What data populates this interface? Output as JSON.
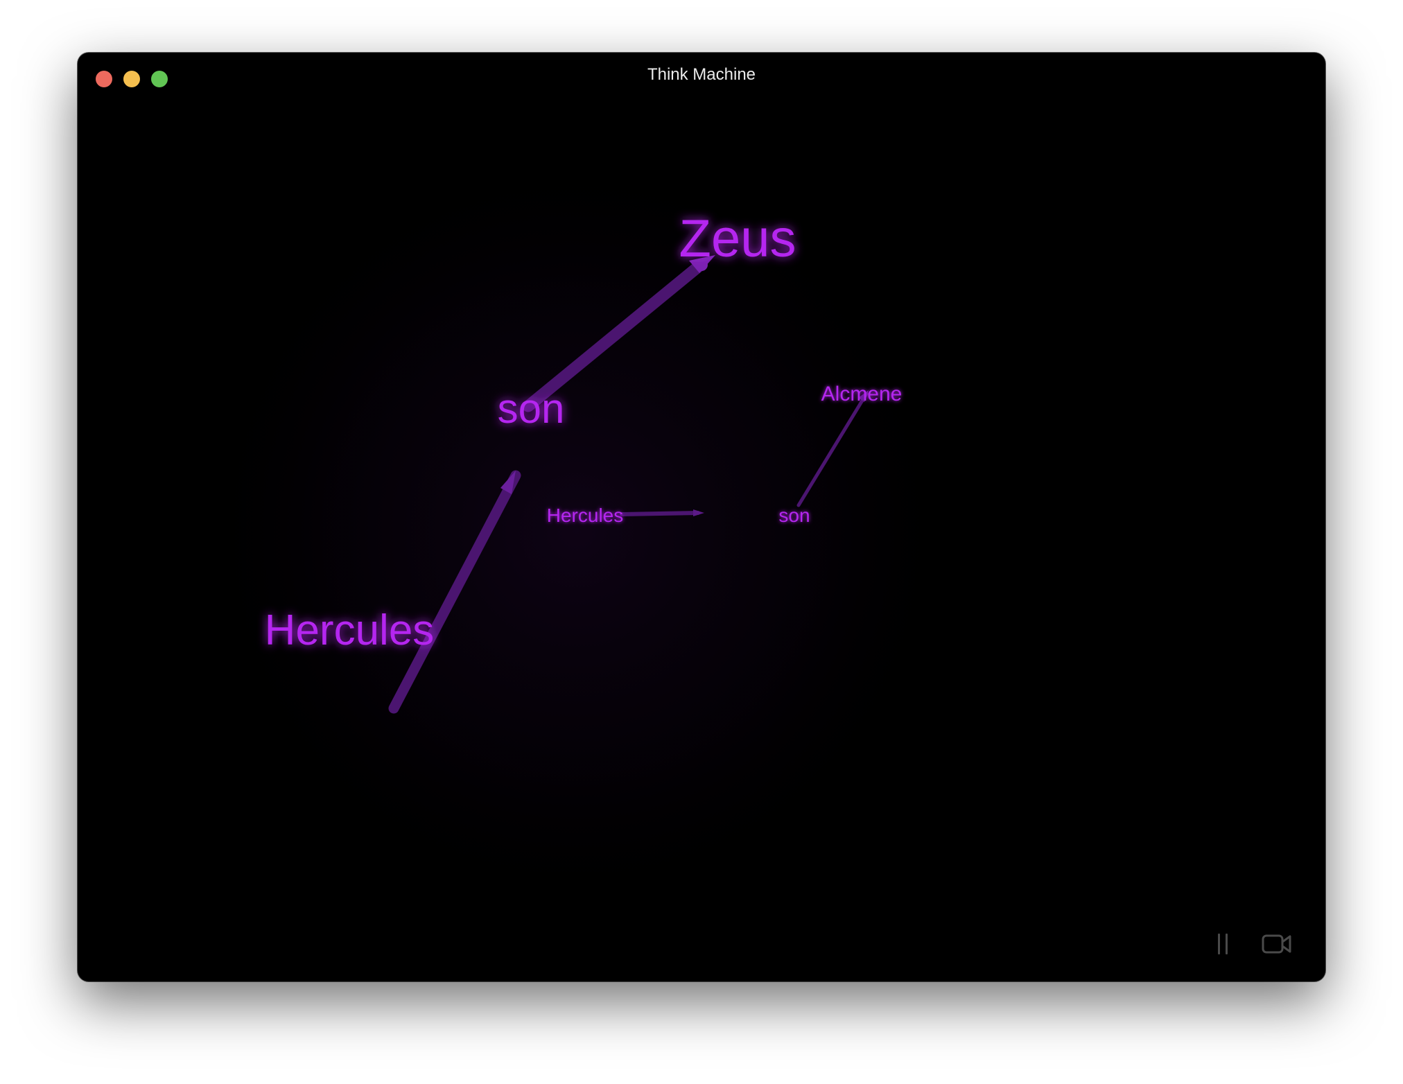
{
  "window": {
    "title": "Think Machine"
  },
  "graph": {
    "node_color": "#b526f0",
    "edge_color": "#5b1a87",
    "nodes": {
      "zeus": "Zeus",
      "son_large": "son",
      "hercules_large": "Hercules",
      "alcmene": "Alcmene",
      "hercules_small": "Hercules",
      "son_small": "son"
    }
  },
  "controls": {
    "pause_icon": "pause-icon",
    "record_icon": "video-camera-icon"
  }
}
